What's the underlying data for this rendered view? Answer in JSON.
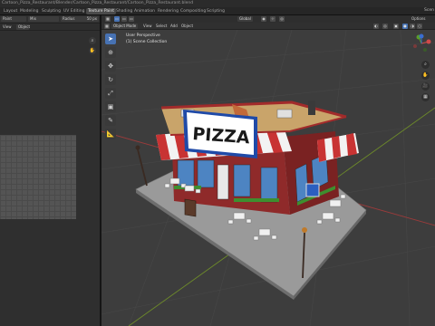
{
  "window": {
    "title": "Cartoon_Pizza_Restaurant/Blender/Cartoon_Pizza_Restaurant/Cartoon_Pizza_Restaurant.blend"
  },
  "workspace_tabs": [
    {
      "label": "Layout",
      "active": false
    },
    {
      "label": "Modeling",
      "active": false
    },
    {
      "label": "Sculpting",
      "active": false
    },
    {
      "label": "UV Editing",
      "active": false
    },
    {
      "label": "Texture Paint",
      "active": true
    },
    {
      "label": "Shading",
      "active": false
    },
    {
      "label": "Animation",
      "active": false
    },
    {
      "label": "Rendering",
      "active": false
    },
    {
      "label": "Compositing",
      "active": false
    },
    {
      "label": "Scripting",
      "active": false
    }
  ],
  "scene_label": "Scen",
  "image_editor": {
    "mode_value": "Paint",
    "mix_value": "Mix",
    "radius_label": "Radius",
    "radius_value": "50 px",
    "view_menu": "View",
    "object_label": "Object"
  },
  "viewport": {
    "mode_value": "Object Mode",
    "menus": [
      "View",
      "Select",
      "Add",
      "Object"
    ],
    "transform_value": "Global",
    "options_label": "Options",
    "perspective_text": "User Perspective",
    "collection_text": "(1) Scene Collection"
  },
  "scene_sign_text": "PIZZA",
  "colors": {
    "accent": "#4772b3",
    "x_axis": "#9b3b3b",
    "y_axis": "#6d8a2a",
    "brick": "#8f2a2a",
    "roof": "#c9a46a",
    "awning_red": "#c83333"
  },
  "icons": {
    "select_tool": "cursor-icon",
    "cursor_tool": "3d-cursor-icon",
    "move_tool": "move-icon",
    "rotate_tool": "rotate-icon",
    "scale_tool": "scale-icon",
    "transform_tool": "transform-icon",
    "annotate_tool": "annotate-icon",
    "measure_tool": "measure-icon"
  }
}
